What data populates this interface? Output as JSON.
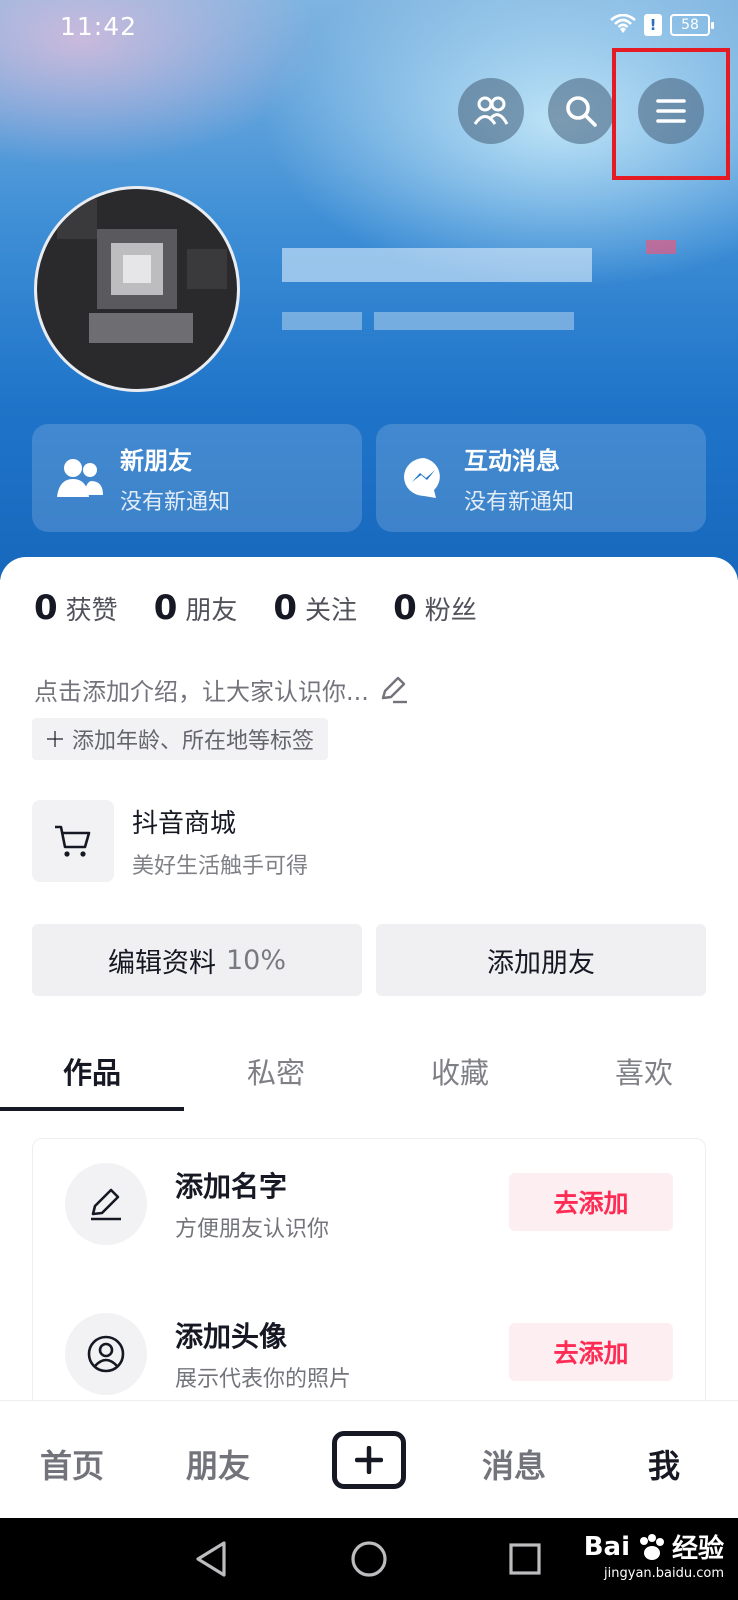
{
  "status_bar": {
    "time": "11:42",
    "battery": "58",
    "alert": "!"
  },
  "profile": {
    "notify_cards": [
      {
        "title": "新朋友",
        "subtitle": "没有新通知"
      },
      {
        "title": "互动消息",
        "subtitle": "没有新通知"
      }
    ],
    "stats": [
      {
        "value": "0",
        "label": "获赞"
      },
      {
        "value": "0",
        "label": "朋友"
      },
      {
        "value": "0",
        "label": "关注"
      },
      {
        "value": "0",
        "label": "粉丝"
      }
    ],
    "bio_placeholder": "点击添加介绍，让大家认识你...",
    "tag_chip": "添加年龄、所在地等标签",
    "mall": {
      "title": "抖音商城",
      "subtitle": "美好生活触手可得"
    },
    "edit_button": {
      "label": "编辑资料",
      "percent": "10%"
    },
    "add_friend_button": "添加朋友"
  },
  "tabs": [
    {
      "label": "作品",
      "active": true
    },
    {
      "label": "私密",
      "active": false
    },
    {
      "label": "收藏",
      "active": false
    },
    {
      "label": "喜欢",
      "active": false
    }
  ],
  "tasks": [
    {
      "title": "添加名字",
      "subtitle": "方便朋友认识你",
      "button": "去添加",
      "icon": "pencil-icon"
    },
    {
      "title": "添加头像",
      "subtitle": "展示代表你的照片",
      "button": "去添加",
      "icon": "user-circle-icon"
    }
  ],
  "bottom_nav": [
    {
      "label": "首页",
      "active": false
    },
    {
      "label": "朋友",
      "active": false
    },
    {
      "label": "消息",
      "active": false
    },
    {
      "label": "我",
      "active": true
    }
  ],
  "watermark": {
    "text": "Bai",
    "text2": "经验",
    "url": "jingyan.baidu.com"
  },
  "colors": {
    "accent": "#fe2c55",
    "highlight": "#e51b23",
    "hero": "#1f74c9"
  }
}
